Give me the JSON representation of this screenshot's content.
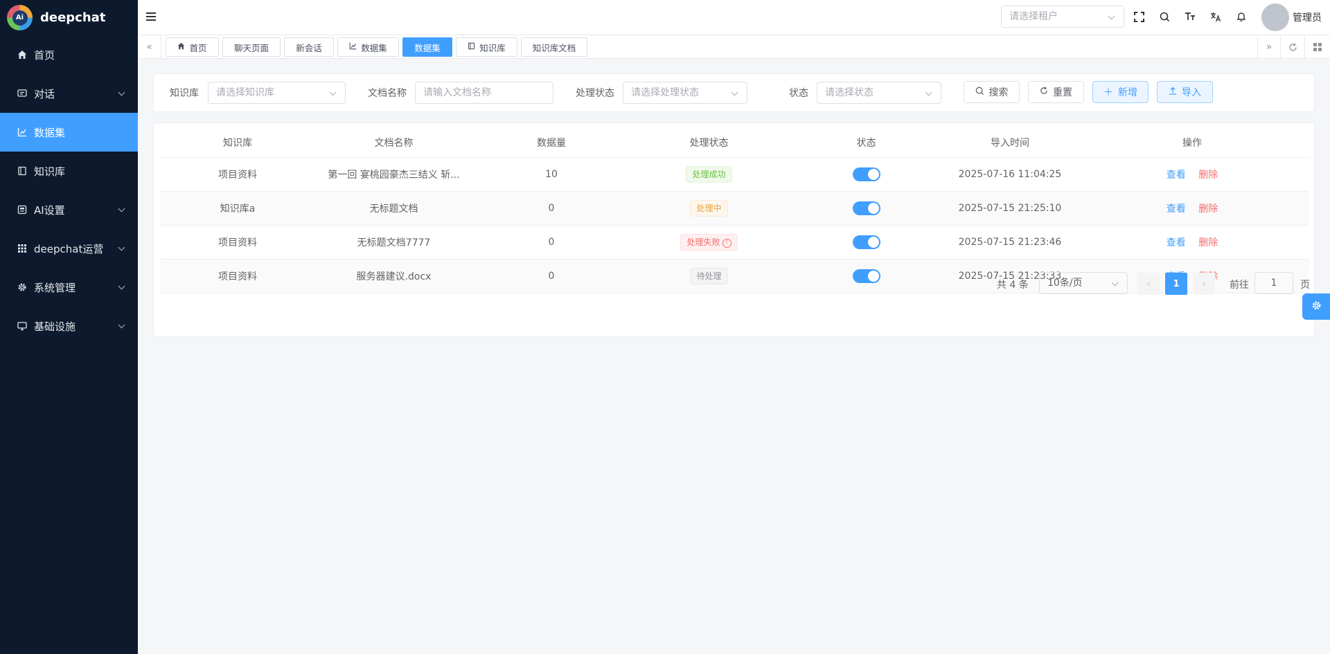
{
  "brand": {
    "name": "deepchat",
    "logo_text": "Ai"
  },
  "sidebar": {
    "items": [
      {
        "label": "首页",
        "icon": "home-icon"
      },
      {
        "label": "对话",
        "icon": "chat-icon",
        "has_children": true
      },
      {
        "label": "数据集",
        "icon": "chart-icon",
        "active": true
      },
      {
        "label": "知识库",
        "icon": "book-icon"
      },
      {
        "label": "AI设置",
        "icon": "ai-settings-icon",
        "has_children": true
      },
      {
        "label": "deepchat运营",
        "icon": "grid-icon",
        "has_children": true
      },
      {
        "label": "系统管理",
        "icon": "gear-icon",
        "has_children": true
      },
      {
        "label": "基础设施",
        "icon": "monitor-icon",
        "has_children": true
      }
    ]
  },
  "header": {
    "tenant_placeholder": "请选择租户",
    "user_name": "管理员"
  },
  "tabs": [
    {
      "label": "首页",
      "icon": "home-icon"
    },
    {
      "label": "聊天页面"
    },
    {
      "label": "新会话"
    },
    {
      "label": "数据集",
      "icon": "chart-icon"
    },
    {
      "label": "数据集",
      "active": true
    },
    {
      "label": "知识库",
      "icon": "book-icon"
    },
    {
      "label": "知识库文档"
    }
  ],
  "filters": {
    "kb_label": "知识库",
    "kb_placeholder": "请选择知识库",
    "doc_label": "文档名称",
    "doc_placeholder": "请输入文档名称",
    "proc_label": "处理状态",
    "proc_placeholder": "请选择处理状态",
    "status_label": "状态",
    "status_placeholder": "请选择状态",
    "search": "搜索",
    "reset": "重置",
    "add": "新增",
    "import": "导入"
  },
  "table": {
    "columns": [
      "知识库",
      "文档名称",
      "数据量",
      "处理状态",
      "状态",
      "导入时间",
      "操作"
    ],
    "rows": [
      {
        "kb": "项目资料",
        "doc": "第一回 宴桃园豪杰三结义 斩...",
        "count": "10",
        "proc": "处理成功",
        "proc_type": "success",
        "enabled": true,
        "time": "2025-07-16 11:04:25"
      },
      {
        "kb": "知识库a",
        "doc": "无标题文档",
        "count": "0",
        "proc": "处理中",
        "proc_type": "warning",
        "enabled": true,
        "time": "2025-07-15 21:25:10"
      },
      {
        "kb": "项目资料",
        "doc": "无标题文档7777",
        "count": "0",
        "proc": "处理失败",
        "proc_type": "danger",
        "enabled": true,
        "time": "2025-07-15 21:23:46"
      },
      {
        "kb": "项目资料",
        "doc": "服务器建议.docx",
        "count": "0",
        "proc": "待处理",
        "proc_type": "info",
        "enabled": true,
        "time": "2025-07-15 21:23:33"
      }
    ],
    "actions": {
      "view": "查看",
      "delete": "删除"
    }
  },
  "pagination": {
    "total": "共 4 条",
    "page_size": "10条/页",
    "current": "1",
    "goto_label": "前往",
    "goto_value": "1",
    "goto_suffix": "页"
  },
  "colors": {
    "primary": "#409eff",
    "sidebar_bg": "#0d1a2d",
    "danger": "#f56c6c",
    "success": "#67c23a",
    "warning": "#e6a23c"
  }
}
